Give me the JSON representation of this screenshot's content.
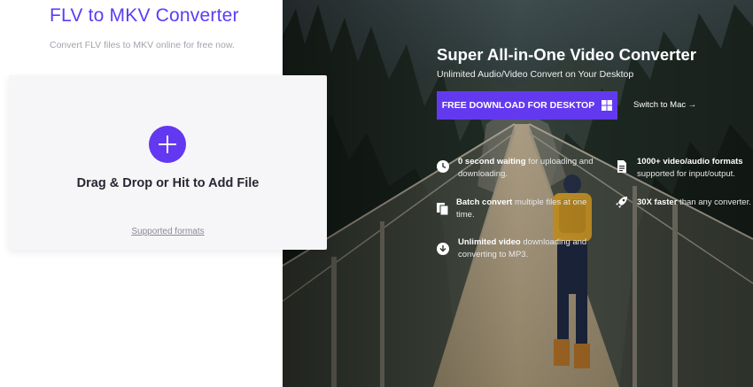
{
  "left": {
    "title": "FLV to MKV Converter",
    "subtitle": "Convert FLV files to MKV online for free now.",
    "drop_label": "Drag & Drop or Hit to Add File",
    "supported_formats": "Supported formats"
  },
  "hero": {
    "title": "Super All-in-One Video Converter",
    "subtitle": "Unlimited Audio/Video Convert on Your Desktop",
    "download_button": "FREE DOWNLOAD FOR DESKTOP",
    "switch_link": "Switch to Mac →",
    "features": [
      {
        "icon": "clock-icon",
        "bold": "0 second waiting",
        "text": " for uploading and downloading."
      },
      {
        "icon": "file-formats-icon",
        "bold": "1000+ video/audio formats",
        "text": " supported for input/output."
      },
      {
        "icon": "copy-files-icon",
        "bold": "Batch convert",
        "text": " multiple files at one time."
      },
      {
        "icon": "rocket-icon",
        "bold": "30X faster",
        "text": " than any converter."
      },
      {
        "icon": "download-circle-icon",
        "bold": "Unlimited video",
        "text": " downloading and converting to MP3."
      }
    ]
  },
  "colors": {
    "brand_purple": "#5b3df5",
    "button_purple": "#6339f0"
  }
}
